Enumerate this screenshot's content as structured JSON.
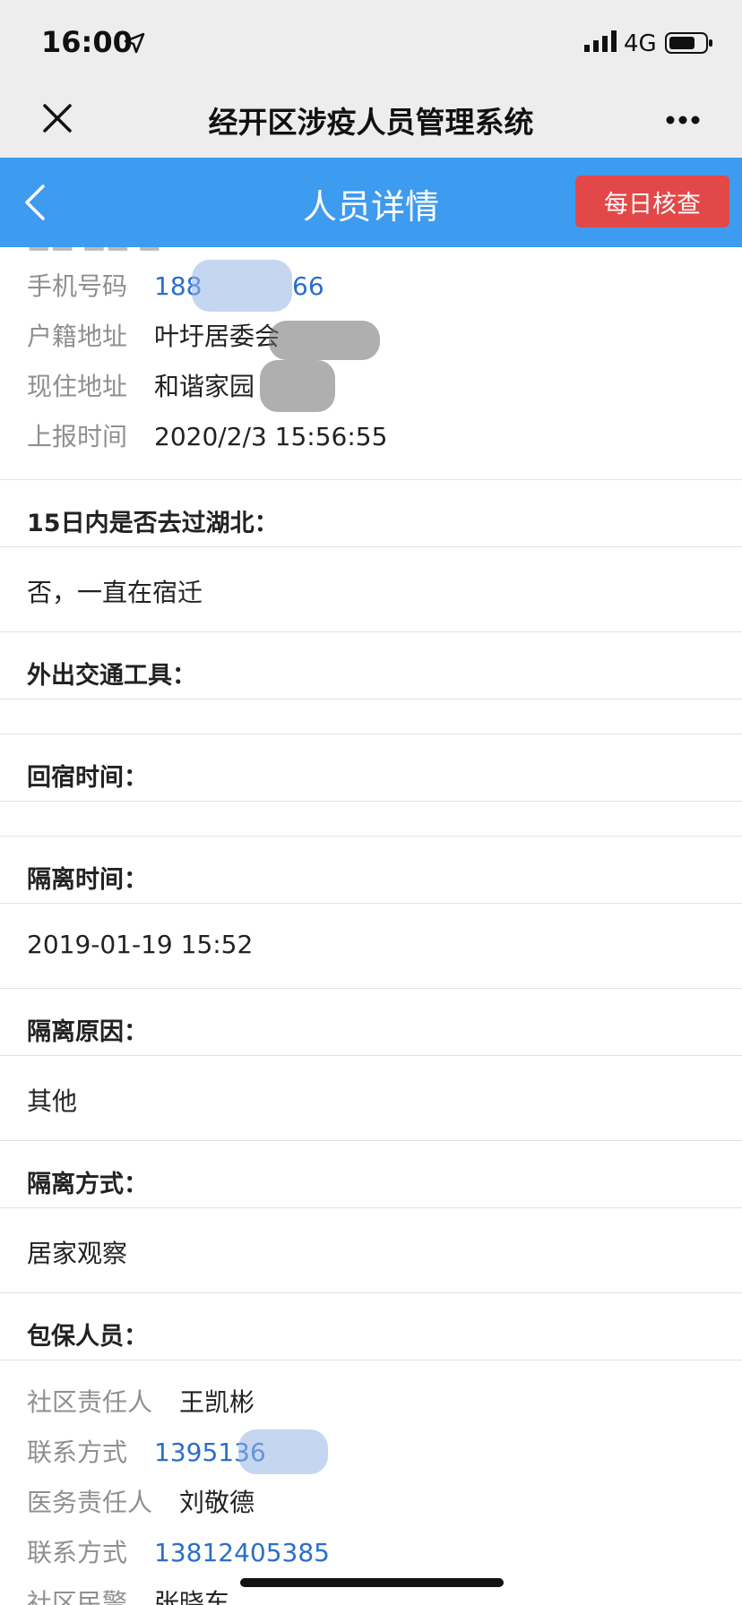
{
  "status_bar": {
    "time": "16:00",
    "network": "4G"
  },
  "wechat_bar": {
    "title": "经开区涉疫人员管理系统",
    "close_icon": "close-icon",
    "more_icon": "more-icon"
  },
  "header": {
    "title": "人员详情",
    "back_icon": "back-icon",
    "daily_check_button": "每日核查",
    "accent": "#3d9bf0",
    "button_color": "#e34848"
  },
  "basic_info": [
    {
      "label": "手机号码",
      "value": "188",
      "value_suffix": "66",
      "type": "phone"
    },
    {
      "label": "户籍地址",
      "value": "叶圩居委会",
      "type": "text"
    },
    {
      "label": "现住地址",
      "value": "和谐家园",
      "type": "text"
    },
    {
      "label": "上报时间",
      "value": "2020/2/3 15:56:55",
      "type": "text"
    }
  ],
  "sections": [
    {
      "question": "15日内是否去过湖北：",
      "answer": "否，一直在宿迁"
    },
    {
      "question": "外出交通工具：",
      "answer": ""
    },
    {
      "question": "回宿时间：",
      "answer": ""
    },
    {
      "question": "隔离时间：",
      "answer": "2019-01-19 15:52"
    },
    {
      "question": "隔离原因：",
      "answer": "其他"
    },
    {
      "question": "隔离方式：",
      "answer": "居家观察"
    },
    {
      "question": "包保人员：",
      "answer": ""
    }
  ],
  "guarantors": [
    {
      "label": "社区责任人",
      "value": "王凯彬",
      "type": "text"
    },
    {
      "label": "联系方式",
      "value": "1395136",
      "type": "phone"
    },
    {
      "label": "医务责任人",
      "value": "刘敬德",
      "type": "text"
    },
    {
      "label": "联系方式",
      "value": "13812405385",
      "type": "phone"
    },
    {
      "label": "社区民警",
      "value": "张晓东",
      "type": "text"
    }
  ]
}
